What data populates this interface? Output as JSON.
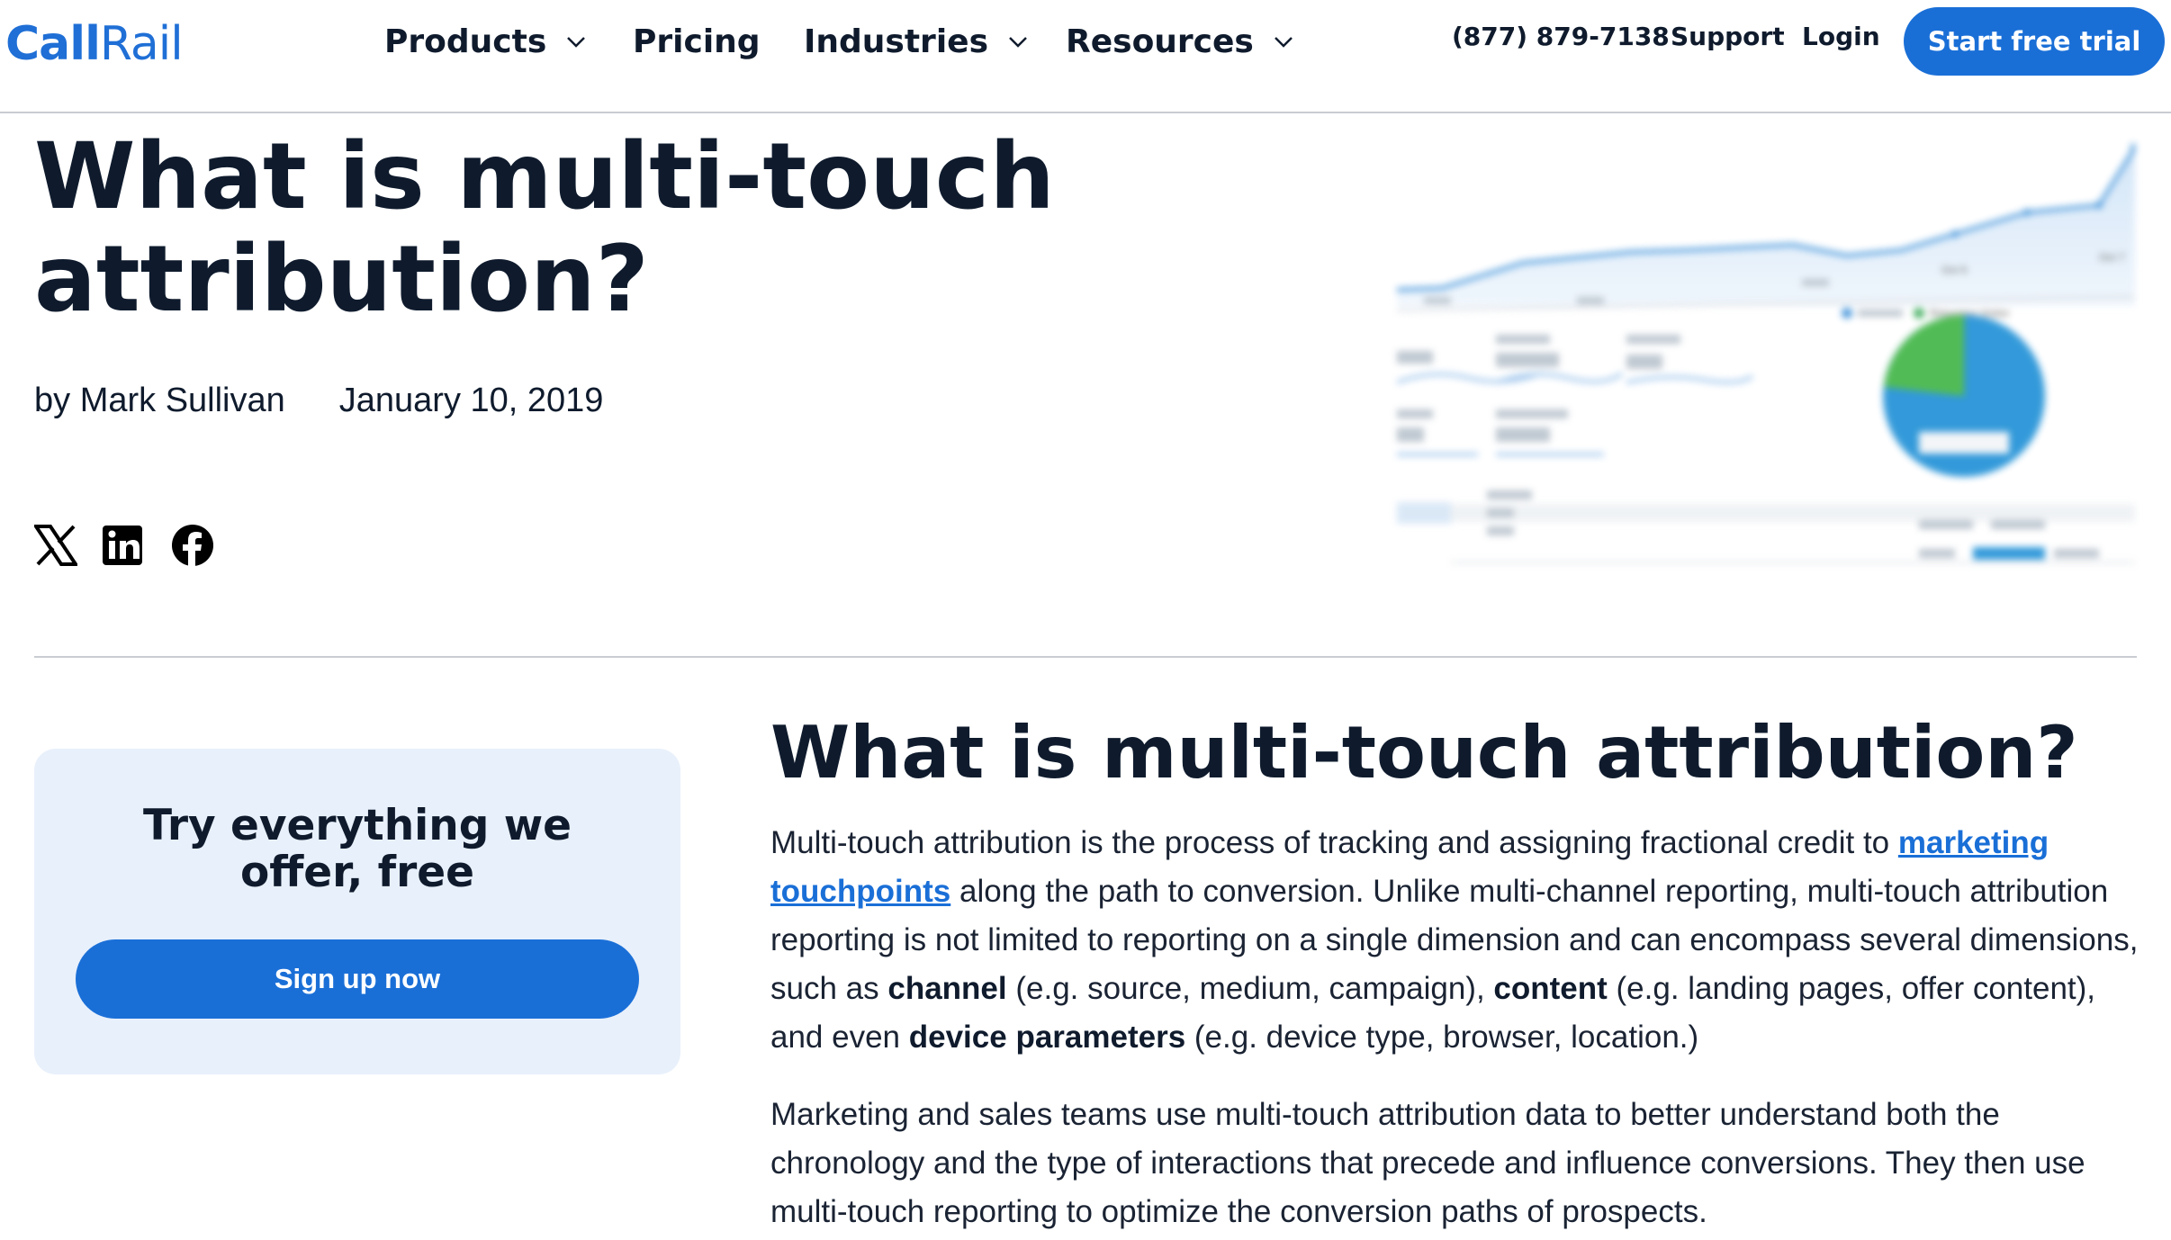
{
  "header": {
    "logo_call": "Call",
    "logo_rail": "Rail",
    "nav": {
      "products": "Products",
      "pricing": "Pricing",
      "industries": "Industries",
      "resources": "Resources"
    },
    "phone": "(877) 879-7138",
    "support": "Support",
    "login": "Login",
    "cta": "Start free trial"
  },
  "hero": {
    "title_line1": "What is multi-touch",
    "title_line2": "attribution?",
    "author": "by Mark Sullivan",
    "date": "January 10, 2019",
    "image": {
      "axis_label_oct5": "Oct 5",
      "axis_label_oct7": "Oct 7",
      "legend_returning": "Returning Visitor"
    }
  },
  "social": {
    "icons": [
      "x-icon",
      "linkedin-icon",
      "facebook-icon"
    ]
  },
  "sidebar_cta": {
    "title": "Try everything we offer, free",
    "button": "Sign up now"
  },
  "article": {
    "heading": "What is multi-touch attribution?",
    "p1": {
      "t1": "Multi-touch attribution is the process of tracking and assigning fractional credit to ",
      "link": "marketing touchpoints",
      "t2": " along the path to conversion. Unlike multi-channel reporting, multi-touch attribution reporting is not limited to reporting on a single dimension and can encompass several dimensions, such as ",
      "b1": "channel",
      "t3": " (e.g. source, medium, campaign), ",
      "b2": "content",
      "t4": " (e.g. landing pages, offer content), and even ",
      "b3": "device parameters",
      "t5": " (e.g. device type, browser, location.)"
    },
    "p2": "Marketing and sales teams use multi-touch attribution data to better understand both the chronology and the type of interactions that precede and influence conversions. They then use multi-touch reporting to optimize the conversion paths of prospects."
  },
  "colors": {
    "brand_blue": "#1a6fd7",
    "text_dark": "#0f1b2d",
    "cta_bg": "#e8f0fb"
  }
}
